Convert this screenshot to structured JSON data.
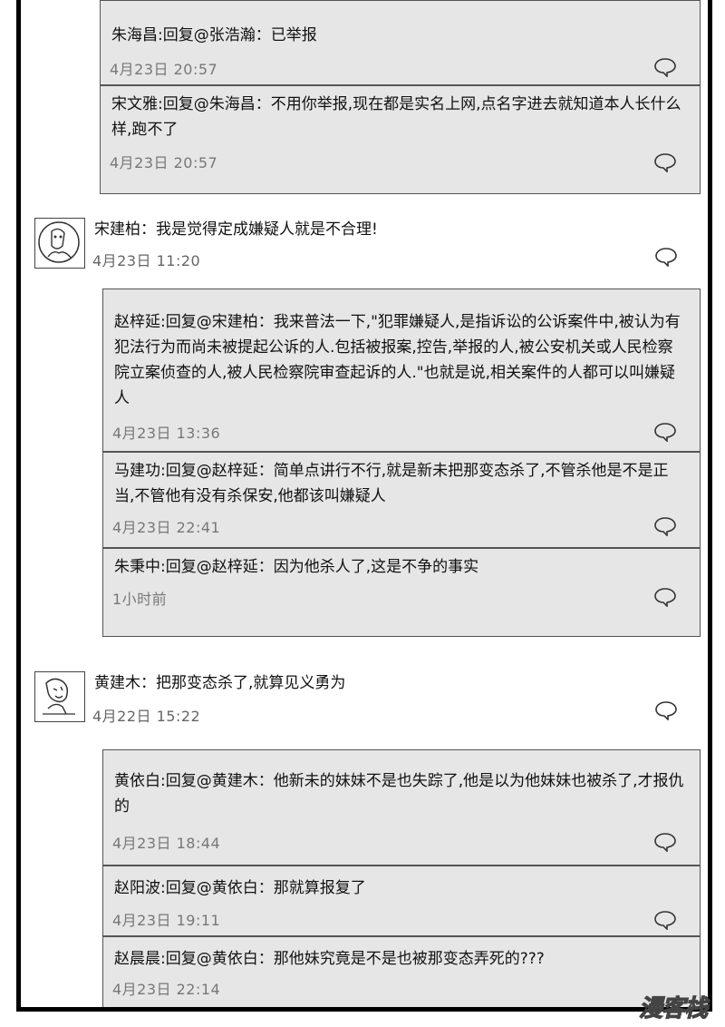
{
  "thread1_replies": [
    {
      "text": "朱海昌:回复@张浩瀚：已举报",
      "time": "4月23日 20:57"
    },
    {
      "text": "宋文雅:回复@朱海昌：不用你举报,现在都是实名上网,点名字进去就知道本人长什么样,跑不了",
      "time": "4月23日 20:57"
    }
  ],
  "comment1": {
    "text": "宋建柏：我是觉得定成嫌疑人就是不合理!",
    "time": "4月23日 11:20"
  },
  "thread2_replies": [
    {
      "text": "赵梓延:回复@宋建柏：我来普法一下,\"犯罪嫌疑人,是指诉讼的公诉案件中,被认为有犯法行为而尚未被提起公诉的人.包括被报案,控告,举报的人,被公安机关或人民检察院立案侦查的人,被人民检察院审查起诉的人.\"也就是说,相关案件的人都可以叫嫌疑人",
      "time": "4月23日 13:36"
    },
    {
      "text": "马建功:回复@赵梓延：简单点讲行不行,就是新未把那变态杀了,不管杀他是不是正当,不管他有没有杀保安,他都该叫嫌疑人",
      "time": "4月23日 22:41"
    },
    {
      "text": "朱秉中:回复@赵梓延：因为他杀人了,这是不争的事实",
      "time": "1小时前"
    }
  ],
  "comment2": {
    "text": "黄建木：把那变态杀了,就算见义勇为",
    "time": "4月22日 15:22"
  },
  "thread3_replies": [
    {
      "text": "黄依白:回复@黄建木：他新未的妹妹不是也失踪了,他是以为他妹妹也被杀了,才报仇的",
      "time": "4月23日 18:44"
    },
    {
      "text": "赵阳波:回复@黄依白：那就算报复了",
      "time": "4月23日 19:11"
    },
    {
      "text": "赵晨晨:回复@黄依白：那他妹究竟是不是也被那变态弄死的???",
      "time": "4月23日 22:14"
    }
  ],
  "icons": {
    "comment": "speech-bubble-icon",
    "avatar1": "cartoon-face-avatar",
    "avatar2": "cartoon-face-avatar"
  },
  "watermark": "漫客栈"
}
